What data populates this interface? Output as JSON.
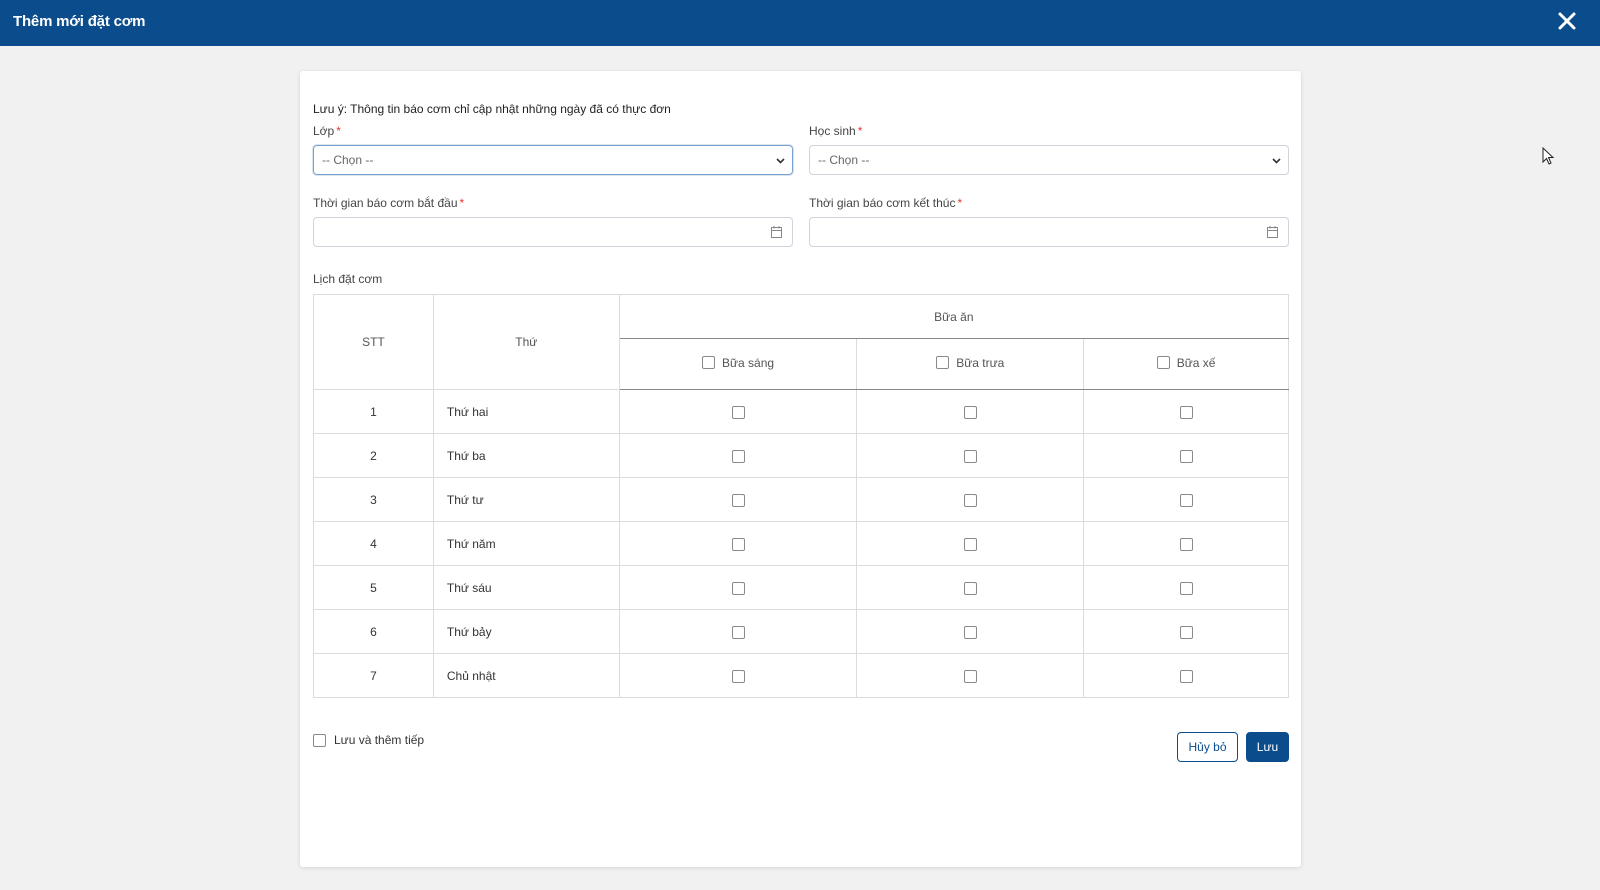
{
  "dialog": {
    "title": "Thêm mới đặt cơm",
    "note": "Lưu ý: Thông tin báo cơm chỉ cập nhật những ngày đã có thực đơn"
  },
  "form": {
    "class_label": "Lớp",
    "class_value": "-- Chọn --",
    "student_label": "Học sinh",
    "student_value": "-- Chọn --",
    "start_label": "Thời gian báo cơm bắt đầu",
    "end_label": "Thời gian báo cơm kết thúc",
    "required_mark": "*"
  },
  "schedule": {
    "label": "Lịch đặt cơm",
    "headers": {
      "stt": "STT",
      "day": "Thứ",
      "meal_group": "Bữa ăn",
      "breakfast": "Bữa sáng",
      "lunch": "Bữa trưa",
      "snack": "Bữa xế"
    },
    "rows": [
      {
        "stt": "1",
        "day": "Thứ hai"
      },
      {
        "stt": "2",
        "day": "Thứ ba"
      },
      {
        "stt": "3",
        "day": "Thứ tư"
      },
      {
        "stt": "4",
        "day": "Thứ năm"
      },
      {
        "stt": "5",
        "day": "Thứ sáu"
      },
      {
        "stt": "6",
        "day": "Thứ bảy"
      },
      {
        "stt": "7",
        "day": "Chủ nhật"
      }
    ]
  },
  "footer": {
    "save_and_continue": "Lưu và thêm tiếp",
    "cancel": "Hủy bỏ",
    "save": "Lưu"
  },
  "colors": {
    "primary": "#0b4d8c",
    "required": "#e53935"
  }
}
